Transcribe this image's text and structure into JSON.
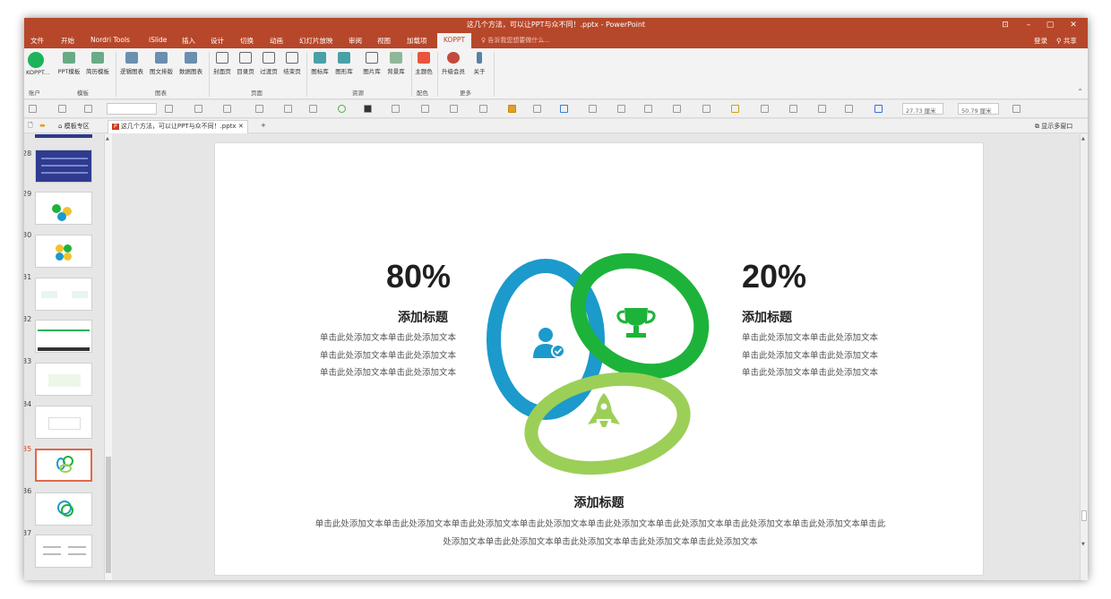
{
  "window": {
    "title": "这几个方法，可以让PPT与众不同！.pptx - PowerPoint"
  },
  "menubar": {
    "tabs": [
      "文件",
      "开始",
      "Nordri Tools",
      "iSlide",
      "插入",
      "设计",
      "切换",
      "动画",
      "幻灯片放映",
      "审阅",
      "视图",
      "加载项",
      "KOPPT"
    ],
    "active_tab": "KOPPT",
    "tell_me": "告诉我您想要做什么...",
    "login": "登录",
    "share": "共享"
  },
  "ribbon": {
    "buttons": [
      "KOPPT...",
      "PPT模板",
      "简历模板",
      "逻辑图表",
      "图文排版",
      "数据图表",
      "封面页",
      "目录页",
      "过渡页",
      "结束页",
      "图标库",
      "图形库",
      "图片库",
      "背景库",
      "主题色",
      "升级会员",
      "关于"
    ],
    "groups": [
      "账户",
      "模板",
      "图表",
      "页面",
      "资源",
      "配色",
      "更多"
    ]
  },
  "toolbar": {
    "width_value": "27.73 厘米",
    "height_value": "50.79 厘米"
  },
  "tabstrip": {
    "home_tab": "模板专区",
    "doc_tab": "这几个方法，可以让PPT与众不同！.pptx",
    "multiwindow": "显示多窗口"
  },
  "thumbnails": {
    "numbers": [
      "28",
      "29",
      "30",
      "31",
      "32",
      "33",
      "34",
      "35",
      "36",
      "37"
    ],
    "selected": "35"
  },
  "slide": {
    "left_percent": "80%",
    "left_title": "添加标题",
    "left_body": "单击此处添加文本单击此处添加文本单击此处添加文本单击此处添加文本单击此处添加文本单击此处添加文本",
    "right_percent": "20%",
    "right_title": "添加标题",
    "right_body": "单击此处添加文本单击此处添加文本单击此处添加文本单击此处添加文本单击此处添加文本单击此处添加文本",
    "bottom_title": "添加标题",
    "bottom_body": "单击此处添加文本单击此处添加文本单击此处添加文本单击此处添加文本单击此处添加文本单击此处添加文本单击此处添加文本单击此处添加文本单击此处添加文本单击此处添加文本单击此处添加文本单击此处添加文本单击此处添加文本",
    "colors": {
      "blue": "#1c9acb",
      "green": "#1db33a",
      "light_green": "#9ccf58"
    },
    "icons": [
      "user-check-icon",
      "trophy-icon",
      "rocket-icon"
    ]
  }
}
